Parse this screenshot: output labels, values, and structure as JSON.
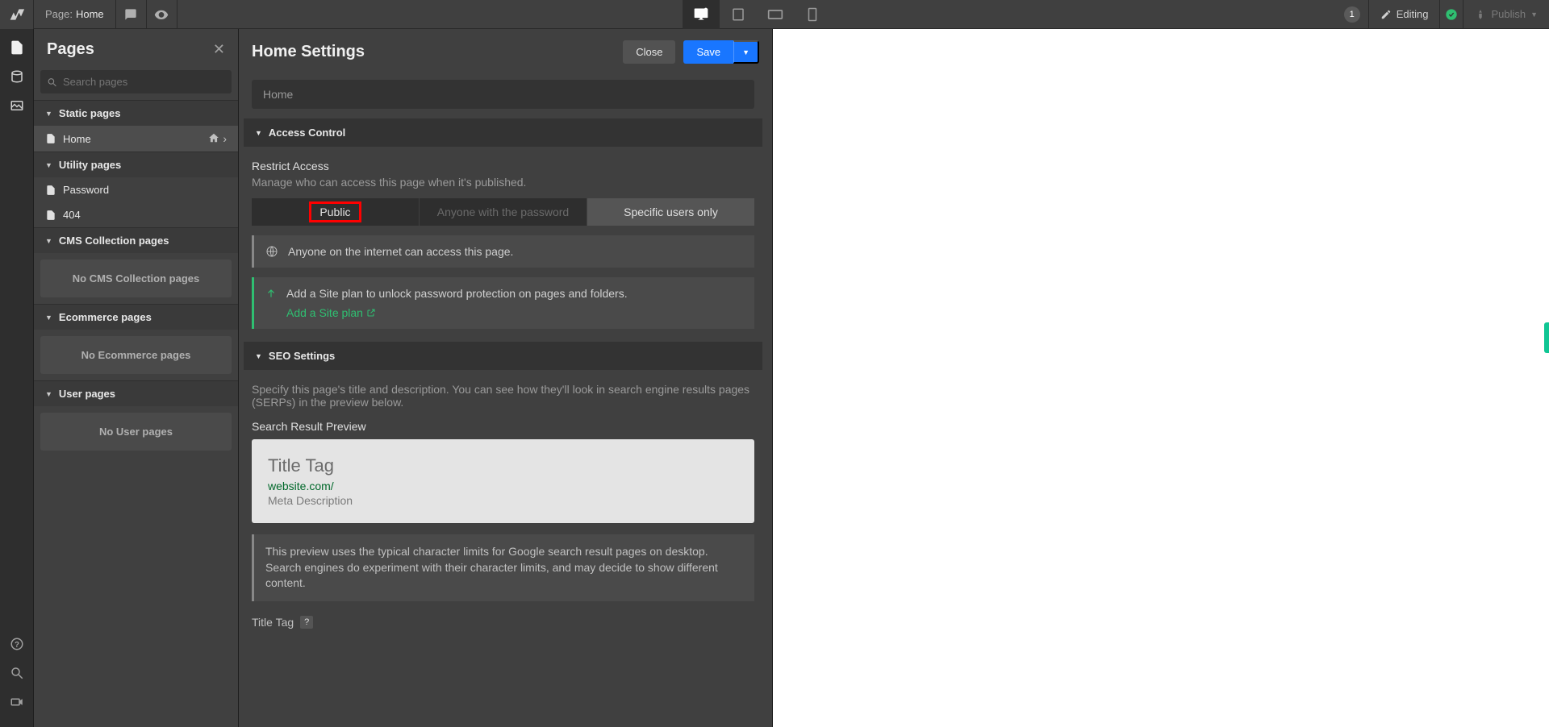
{
  "topbar": {
    "page_label": "Page:",
    "page_value": "Home",
    "badge_count": "1",
    "editing": "Editing",
    "publish": "Publish"
  },
  "pages_panel": {
    "title": "Pages",
    "search_placeholder": "Search pages",
    "sections": {
      "static": "Static pages",
      "utility": "Utility pages",
      "cms": "CMS Collection pages",
      "ecom": "Ecommerce pages",
      "user": "User pages"
    },
    "items": {
      "home": "Home",
      "password": "Password",
      "notfound": "404"
    },
    "empty": {
      "cms": "No CMS Collection pages",
      "ecom": "No Ecommerce pages",
      "user": "No User pages"
    }
  },
  "settings": {
    "title": "Home Settings",
    "close": "Close",
    "save": "Save",
    "name_value": "Home",
    "access": {
      "header": "Access Control",
      "label": "Restrict Access",
      "desc": "Manage who can access this page when it's published.",
      "opts": {
        "public": "Public",
        "password": "Anyone with the password",
        "users": "Specific users only"
      },
      "info": "Anyone on the internet can access this page.",
      "upsell_text": "Add a Site plan to unlock password protection on pages and folders.",
      "upsell_link": "Add a Site plan"
    },
    "seo": {
      "header": "SEO Settings",
      "desc": "Specify this page's title and description. You can see how they'll look in search engine results pages (SERPs) in the preview below.",
      "preview_label": "Search Result Preview",
      "serp": {
        "title": "Title Tag",
        "url": "website.com/",
        "desc": "Meta Description"
      },
      "note": "This preview uses the typical character limits for Google search result pages on desktop. Search engines do experiment with their character limits, and may decide to show different content.",
      "title_tag_label": "Title Tag"
    }
  }
}
